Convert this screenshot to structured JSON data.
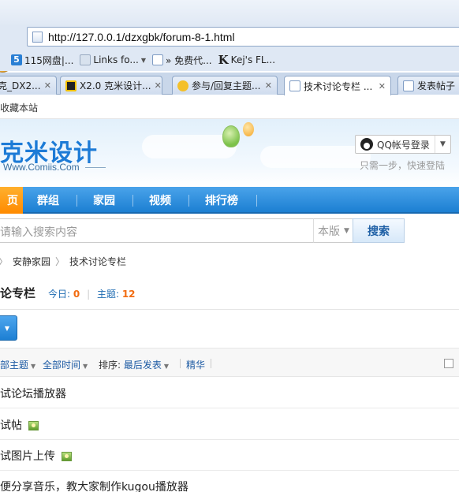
{
  "browser": {
    "url": "http://127.0.0.1/dzxgbk/forum-8-1.html",
    "bookmarks": [
      "115网盘|...",
      "Links fo...",
      "» 免费代...",
      "Kej's FL..."
    ],
    "tabs": [
      {
        "label": "克_DX2...",
        "active": false
      },
      {
        "label": "X2.0 克米设计...",
        "active": false
      },
      {
        "label": "参与/回复主题...",
        "active": false
      },
      {
        "label": "技术讨论专栏 ...",
        "active": true
      },
      {
        "label": "发表帖子",
        "active": false
      }
    ]
  },
  "site": {
    "topbar_text": "收藏本站",
    "logo_text": "克米设计",
    "logo_sub": "Www.Comiis.Com",
    "qq_login_label": "QQ帐号登录",
    "qq_hint": "只需一步，快速登陆"
  },
  "nav": {
    "home": "页",
    "items": [
      "群组",
      "家园",
      "视频",
      "排行榜"
    ]
  },
  "search": {
    "placeholder": "请输入搜索内容",
    "scope": "本版",
    "button": "搜索"
  },
  "breadcrumb": {
    "items": [
      "安静家园",
      "技术讨论专栏"
    ]
  },
  "forum": {
    "title": "论专栏",
    "today_label": "今日:",
    "today_value": "0",
    "threads_label": "主题:",
    "threads_value": "12"
  },
  "filters": {
    "all_threads": "部主题",
    "all_time": "全部时间",
    "sort_label": "排序:",
    "sort_value": "最后发表",
    "digest": "精华"
  },
  "threads": [
    {
      "title": "试论坛播放器",
      "has_image": false
    },
    {
      "title": "试帖",
      "has_image": true
    },
    {
      "title": "试图片上传",
      "has_image": true
    },
    {
      "title": "便分享音乐，教大家制作kugou播放器",
      "has_image": false
    }
  ]
}
